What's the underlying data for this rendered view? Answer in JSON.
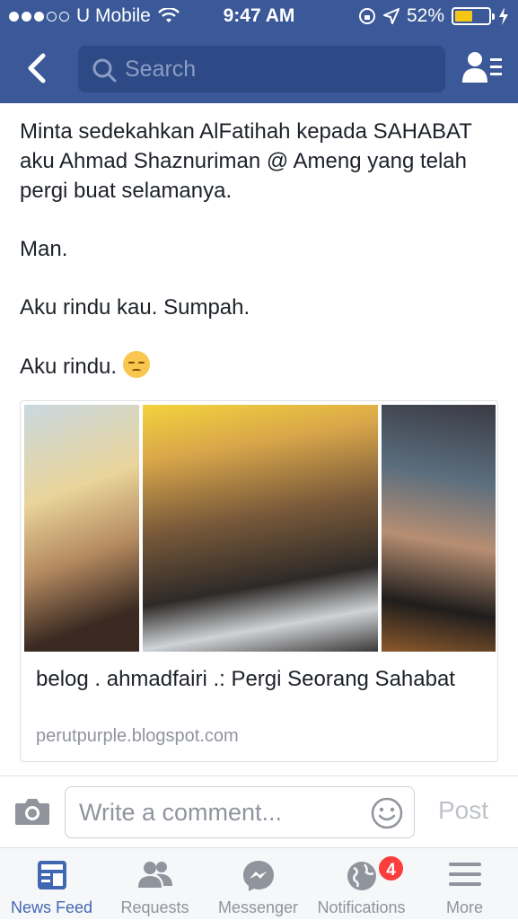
{
  "status_bar": {
    "carrier": "U Mobile",
    "time": "9:47 AM",
    "battery": "52%"
  },
  "search": {
    "placeholder": "Search"
  },
  "post": {
    "paragraphs": [
      "Minta sedekahkan AlFatihah kepada SAHABAT aku Ahmad Shaznuriman @ Ameng yang telah pergi buat selamanya.",
      "Man.",
      "Aku rindu kau. Sumpah.",
      "Aku rindu."
    ]
  },
  "link_card": {
    "title": "belog . ahmadfairi .: Pergi Seorang Sahabat",
    "domain": "perutpurple.blogspot.com"
  },
  "comment_bar": {
    "placeholder": "Write a comment...",
    "post_label": "Post"
  },
  "tabs": [
    {
      "label": "News Feed",
      "icon": "news-feed-icon",
      "active": true
    },
    {
      "label": "Requests",
      "icon": "friend-requests-icon"
    },
    {
      "label": "Messenger",
      "icon": "messenger-icon"
    },
    {
      "label": "Notifications",
      "icon": "globe-icon",
      "badge": "4"
    },
    {
      "label": "More",
      "icon": "menu-icon"
    }
  ],
  "colors": {
    "brand": "#3b5998",
    "active_tab": "#4267b2",
    "badge": "#fa3e3e"
  }
}
